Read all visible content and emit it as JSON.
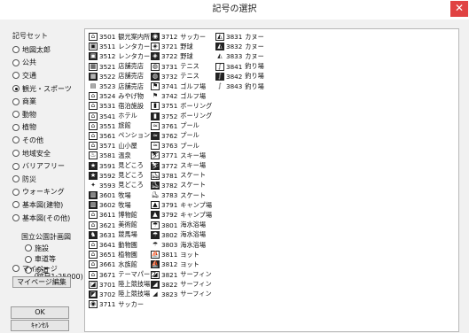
{
  "window": {
    "title": "記号の選択",
    "close_glyph": "✕"
  },
  "sidebar": {
    "group_label": "記号セット",
    "options": [
      {
        "label": "地図太郎",
        "selected": false
      },
      {
        "label": "公共",
        "selected": false
      },
      {
        "label": "交通",
        "selected": false
      },
      {
        "label": "観光・スポーツ",
        "selected": true
      },
      {
        "label": "商業",
        "selected": false
      },
      {
        "label": "動物",
        "selected": false
      },
      {
        "label": "植物",
        "selected": false
      },
      {
        "label": "その他",
        "selected": false
      },
      {
        "label": "地域安全",
        "selected": false
      },
      {
        "label": "バリアフリー",
        "selected": false
      },
      {
        "label": "防災",
        "selected": false
      },
      {
        "label": "ウォーキング",
        "selected": false
      },
      {
        "label": "基本図(建物)",
        "selected": false
      },
      {
        "label": "基本図(その他)",
        "selected": false
      }
    ],
    "national_park": {
      "title": "国立公園計画図",
      "options": [
        {
          "label": "施設",
          "selected": false
        },
        {
          "label": "車道等",
          "selected": false
        },
        {
          "label": "歩道",
          "selected": false
        }
      ],
      "scale_note": "(縮尺1:25000)"
    },
    "mypage": {
      "label": "マイページ",
      "selected": false,
      "edit_button": "マイページ編集"
    },
    "ok_button": "OK",
    "cancel_button": "ｷｬﾝｾﾙ"
  },
  "symbols": {
    "columns": [
      [
        {
          "code": "3501",
          "name": "観光案内所",
          "icon": "tourist-info-icon",
          "glyph": "⌂",
          "style": "box"
        },
        {
          "code": "3511",
          "name": "レンタカー",
          "icon": "rental-car-icon",
          "glyph": "▣",
          "style": "box"
        },
        {
          "code": "3512",
          "name": "レンタカー",
          "icon": "rental-car-icon",
          "glyph": "▣",
          "style": "fill"
        },
        {
          "code": "3521",
          "name": "店舗売店",
          "icon": "shop-icon",
          "glyph": "▦",
          "style": "box"
        },
        {
          "code": "3522",
          "name": "店舗売店",
          "icon": "shop-icon",
          "glyph": "▦",
          "style": "fill"
        },
        {
          "code": "3523",
          "name": "店舗売店",
          "icon": "shop-icon",
          "glyph": "▤",
          "style": "line"
        },
        {
          "code": "3524",
          "name": "みやげ物",
          "icon": "souvenir-icon",
          "glyph": "⌂",
          "style": "box"
        },
        {
          "code": "3531",
          "name": "宿泊施設",
          "icon": "lodging-icon",
          "glyph": "⌂",
          "style": "box"
        },
        {
          "code": "3541",
          "name": "ホテル",
          "icon": "hotel-icon",
          "glyph": "⌂",
          "style": "box"
        },
        {
          "code": "3551",
          "name": "旅館",
          "icon": "inn-icon",
          "glyph": "⌂",
          "style": "box"
        },
        {
          "code": "3561",
          "name": "ペンション",
          "icon": "pension-icon",
          "glyph": "⌂",
          "style": "box"
        },
        {
          "code": "3571",
          "name": "山小屋",
          "icon": "mountain-hut-icon",
          "glyph": "⌂",
          "style": "box"
        },
        {
          "code": "3581",
          "name": "温泉",
          "icon": "hot-spring-icon",
          "glyph": "♨",
          "style": "box"
        },
        {
          "code": "3591",
          "name": "見どころ",
          "icon": "sightseeing-icon",
          "glyph": "★",
          "style": "fill"
        },
        {
          "code": "3592",
          "name": "見どころ",
          "icon": "sightseeing-icon",
          "glyph": "★",
          "style": "fill"
        },
        {
          "code": "3593",
          "name": "見どころ",
          "icon": "sightseeing-icon",
          "glyph": "✦",
          "style": "line"
        },
        {
          "code": "3601",
          "name": "牧場",
          "icon": "ranch-icon",
          "glyph": "▥",
          "style": "fill"
        },
        {
          "code": "3602",
          "name": "牧場",
          "icon": "ranch-icon",
          "glyph": "▥",
          "style": "fill"
        },
        {
          "code": "3611",
          "name": "博物館",
          "icon": "museum-icon",
          "glyph": "⌂",
          "style": "box"
        },
        {
          "code": "3621",
          "name": "美術館",
          "icon": "art-museum-icon",
          "glyph": "⌂",
          "style": "box"
        },
        {
          "code": "3631",
          "name": "競馬場",
          "icon": "racecourse-icon",
          "glyph": "♞",
          "style": "fill"
        },
        {
          "code": "3641",
          "name": "動物園",
          "icon": "zoo-icon",
          "glyph": "⌂",
          "style": "box"
        },
        {
          "code": "3651",
          "name": "植物園",
          "icon": "botanical-garden-icon",
          "glyph": "⌂",
          "style": "box"
        },
        {
          "code": "3661",
          "name": "水族館",
          "icon": "aquarium-icon",
          "glyph": "⌂",
          "style": "box"
        },
        {
          "code": "3671",
          "name": "テーマパーク",
          "icon": "theme-park-icon",
          "glyph": "⌂",
          "style": "box"
        },
        {
          "code": "3701",
          "name": "陸上競技場",
          "icon": "athletics-stadium-icon",
          "glyph": "◪",
          "style": "box"
        },
        {
          "code": "3702",
          "name": "陸上競技場",
          "icon": "athletics-stadium-icon",
          "glyph": "◪",
          "style": "fill"
        },
        {
          "code": "3711",
          "name": "サッカー",
          "icon": "soccer-icon",
          "glyph": "◉",
          "style": "box"
        }
      ],
      [
        {
          "code": "3712",
          "name": "サッカー",
          "icon": "soccer-icon",
          "glyph": "◉",
          "style": "fill"
        },
        {
          "code": "3721",
          "name": "野球",
          "icon": "baseball-icon",
          "glyph": "◈",
          "style": "box"
        },
        {
          "code": "3722",
          "name": "野球",
          "icon": "baseball-icon",
          "glyph": "◈",
          "style": "fill"
        },
        {
          "code": "3731",
          "name": "テニス",
          "icon": "tennis-icon",
          "glyph": "◍",
          "style": "box"
        },
        {
          "code": "3732",
          "name": "テニス",
          "icon": "tennis-icon",
          "glyph": "◍",
          "style": "fill"
        },
        {
          "code": "3741",
          "name": "ゴルフ場",
          "icon": "golf-icon",
          "glyph": "⚑",
          "style": "box"
        },
        {
          "code": "3742",
          "name": "ゴルフ場",
          "icon": "golf-icon",
          "glyph": "⚑",
          "style": "line"
        },
        {
          "code": "3751",
          "name": "ボーリング",
          "icon": "bowling-icon",
          "glyph": "▮",
          "style": "box"
        },
        {
          "code": "3752",
          "name": "ボーリング",
          "icon": "bowling-icon",
          "glyph": "▮",
          "style": "fill"
        },
        {
          "code": "3761",
          "name": "プール",
          "icon": "pool-icon",
          "glyph": "≈",
          "style": "box"
        },
        {
          "code": "3762",
          "name": "プール",
          "icon": "pool-icon",
          "glyph": "≈",
          "style": "fill"
        },
        {
          "code": "3763",
          "name": "プール",
          "icon": "pool-icon",
          "glyph": "≈",
          "style": "box"
        },
        {
          "code": "3771",
          "name": "スキー場",
          "icon": "ski-icon",
          "glyph": "⛷",
          "style": "box"
        },
        {
          "code": "3772",
          "name": "スキー場",
          "icon": "ski-icon",
          "glyph": "⛷",
          "style": "fill"
        },
        {
          "code": "3781",
          "name": "スケート",
          "icon": "skate-icon",
          "glyph": "⛸",
          "style": "box"
        },
        {
          "code": "3782",
          "name": "スケート",
          "icon": "skate-icon",
          "glyph": "⛸",
          "style": "fill"
        },
        {
          "code": "3783",
          "name": "スケート",
          "icon": "skate-icon",
          "glyph": "⛸",
          "style": "line"
        },
        {
          "code": "3791",
          "name": "キャンプ場",
          "icon": "campsite-icon",
          "glyph": "▲",
          "style": "box"
        },
        {
          "code": "3792",
          "name": "キャンプ場",
          "icon": "campsite-icon",
          "glyph": "▲",
          "style": "fill"
        },
        {
          "code": "3801",
          "name": "海水浴場",
          "icon": "beach-icon",
          "glyph": "☂",
          "style": "box"
        },
        {
          "code": "3802",
          "name": "海水浴場",
          "icon": "beach-icon",
          "glyph": "☂",
          "style": "fill"
        },
        {
          "code": "3803",
          "name": "海水浴場",
          "icon": "beach-icon",
          "glyph": "☂",
          "style": "line"
        },
        {
          "code": "3811",
          "name": "ヨット",
          "icon": "yacht-icon",
          "glyph": "⛵",
          "style": "box"
        },
        {
          "code": "3812",
          "name": "ヨット",
          "icon": "yacht-icon",
          "glyph": "⛵",
          "style": "fill"
        },
        {
          "code": "3821",
          "name": "サーフィン",
          "icon": "surfing-icon",
          "glyph": "◢",
          "style": "box"
        },
        {
          "code": "3822",
          "name": "サーフィン",
          "icon": "surfing-icon",
          "glyph": "◢",
          "style": "fill"
        },
        {
          "code": "3823",
          "name": "サーフィン",
          "icon": "surfing-icon",
          "glyph": "◢",
          "style": "line"
        }
      ],
      [
        {
          "code": "3831",
          "name": "カヌー",
          "icon": "canoe-icon",
          "glyph": "◭",
          "style": "box"
        },
        {
          "code": "3832",
          "name": "カヌー",
          "icon": "canoe-icon",
          "glyph": "◭",
          "style": "fill"
        },
        {
          "code": "3833",
          "name": "カヌー",
          "icon": "canoe-icon",
          "glyph": "◭",
          "style": "line"
        },
        {
          "code": "3841",
          "name": "釣り場",
          "icon": "fishing-icon",
          "glyph": "∫",
          "style": "box"
        },
        {
          "code": "3842",
          "name": "釣り場",
          "icon": "fishing-icon",
          "glyph": "∫",
          "style": "fill"
        },
        {
          "code": "3843",
          "name": "釣り場",
          "icon": "fishing-icon",
          "glyph": "∫",
          "style": "line"
        }
      ]
    ]
  }
}
